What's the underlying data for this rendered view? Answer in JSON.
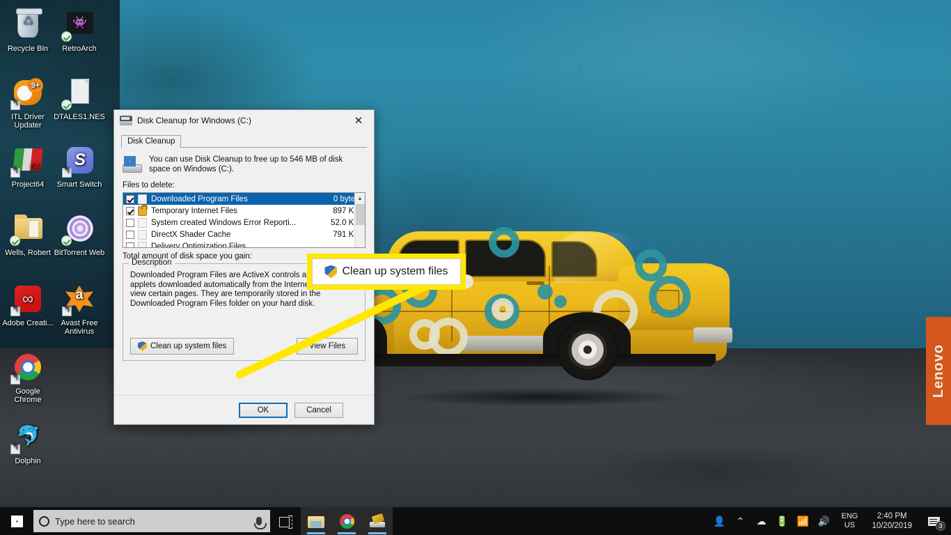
{
  "desktop": {
    "icons": [
      {
        "label": "Recycle Bin",
        "icon": "recycle-bin-icon",
        "overlay": "none"
      },
      {
        "label": "RetroArch",
        "icon": "retroarch-icon",
        "overlay": "sync-check"
      },
      {
        "label": "ITL Driver Updater",
        "icon": "itl-driver-updater-icon",
        "overlay": "shortcut",
        "badge": "9+"
      },
      {
        "label": "DTALES1.NES",
        "icon": "nes-file-icon",
        "overlay": "sync-check"
      },
      {
        "label": "Project64",
        "icon": "project64-icon",
        "overlay": "shortcut"
      },
      {
        "label": "Smart Switch",
        "icon": "smart-switch-icon",
        "overlay": "shortcut"
      },
      {
        "label": "Wells, Robert",
        "icon": "folder-icon",
        "overlay": "sync-check"
      },
      {
        "label": "BitTorrent Web",
        "icon": "bittorrent-web-icon",
        "overlay": "sync-check"
      },
      {
        "label": "Adobe Creati...",
        "icon": "adobe-creative-cloud-icon",
        "overlay": "shortcut"
      },
      {
        "label": "Avast Free Antivirus",
        "icon": "avast-icon",
        "overlay": "shortcut"
      },
      {
        "label": "Google Chrome",
        "icon": "chrome-icon",
        "overlay": "shortcut"
      },
      {
        "label": "Dolphin",
        "icon": "dolphin-icon",
        "overlay": "shortcut"
      }
    ],
    "wallpaper": {
      "brand_tag": "Lenovo",
      "brand_tag_color": "#d4571b",
      "wall_color": "#2a82a0",
      "car_color": "#edb91c",
      "ground_color": "#34383c"
    }
  },
  "dialog": {
    "title": "Disk Cleanup for Windows (C:)",
    "title_icon": "disk-cleanup-icon",
    "close_icon": "close-icon",
    "tab": "Disk Cleanup",
    "header_icon": "drive-windows-icon",
    "header_text": "You can use Disk Cleanup to free up to 546 MB of disk space on Windows (C:).",
    "files_label": "Files to delete:",
    "files": [
      {
        "name": "Downloaded Program Files",
        "size": "0 bytes",
        "checked": true,
        "selected": true,
        "icon": "program-files-icon"
      },
      {
        "name": "Temporary Internet Files",
        "size": "897 KB",
        "checked": true,
        "selected": false,
        "icon": "lock-icon"
      },
      {
        "name": "System created Windows Error Reporti...",
        "size": "52.0 KB",
        "checked": false,
        "selected": false,
        "icon": "file-icon"
      },
      {
        "name": "DirectX Shader Cache",
        "size": "791 KB",
        "checked": false,
        "selected": false,
        "icon": "file-icon"
      },
      {
        "name": "Delivery Optimization Files",
        "size": "",
        "checked": false,
        "selected": false,
        "icon": "file-icon"
      }
    ],
    "scroll_up_icon": "chevron-up-icon",
    "total_label": "Total amount of disk space you gain:",
    "description_legend": "Description",
    "description_text": "Downloaded Program Files are ActiveX controls and Java applets downloaded automatically from the Internet when you view certain pages. They are temporarily stored in the Downloaded Program Files folder on your hard disk.",
    "clean_up_button": "Clean up system files",
    "clean_up_icon": "uac-shield-icon",
    "view_files_button": "View Files",
    "ok_button": "OK",
    "cancel_button": "Cancel"
  },
  "callout": {
    "label": "Clean up system files",
    "icon": "uac-shield-icon",
    "highlight_color": "#ffe800",
    "pointer_color": "#ffe800"
  },
  "taskbar": {
    "start_icon": "windows-start-icon",
    "search_icon": "search-circle-icon",
    "search_placeholder": "Type here to search",
    "mic_icon": "microphone-icon",
    "task_view_icon": "task-view-icon",
    "pinned": [
      {
        "name": "file-explorer-icon",
        "active": true
      },
      {
        "name": "google-chrome-icon",
        "active": true
      },
      {
        "name": "disk-cleanup-icon",
        "active": true
      }
    ],
    "tray": {
      "icons": [
        "people-icon",
        "show-hidden-icons-chevron",
        "onedrive-cloud-icon",
        "battery-icon",
        "wifi-icon",
        "volume-icon"
      ],
      "language_line1": "ENG",
      "language_line2": "US",
      "time": "2:40 PM",
      "date": "10/20/2019",
      "notifications_icon": "action-center-icon",
      "notifications_count": "3"
    }
  }
}
